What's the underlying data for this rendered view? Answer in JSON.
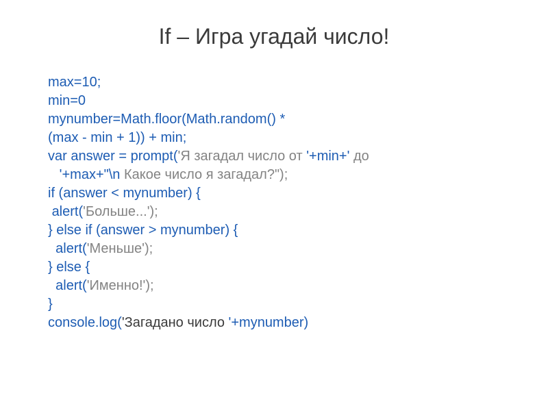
{
  "title": "If – Игра угадай число!",
  "code": {
    "line1": "max=10;",
    "line2": "min=0",
    "line3": "mynumber=Math.floor(Math.random() *",
    "line4": "(max - min + 1)) + min;",
    "line5_blue": "var answer = prompt(",
    "line5_gray": "'Я загадал число от ",
    "line5_blue2": "'+min+'",
    "line5_gray2": " до",
    "line6_blue": "   '+max+\"\\n",
    "line6_gray": " Какое число я загадал?\");",
    "line7": "if (answer < mynumber) {",
    "line8_blue": " alert(",
    "line8_gray": "'Больше...');",
    "line9": "} else if (answer > mynumber) {",
    "line10_blue": "  alert(",
    "line10_gray": "'Меньше');",
    "line11": "} else {",
    "line12_blue": "  alert(",
    "line12_gray": "'Именно!');",
    "line13": "}",
    "line14_blue1": "console.log(",
    "line14_black": "'Загадано число ",
    "line14_blue2": "'+mynumber)"
  }
}
